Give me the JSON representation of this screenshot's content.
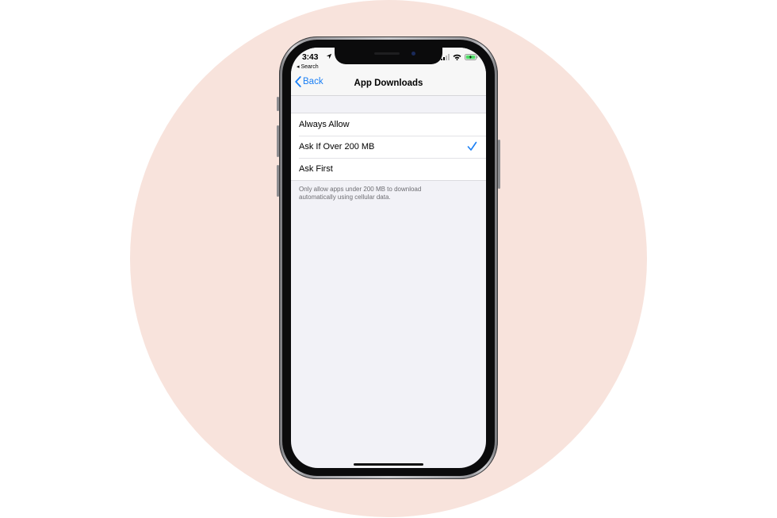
{
  "status_bar": {
    "time": "3:43",
    "back_to_app": "◂ Search"
  },
  "nav": {
    "back_label": "Back",
    "title": "App Downloads"
  },
  "options": [
    {
      "label": "Always Allow",
      "selected": false
    },
    {
      "label": "Ask If Over 200 MB",
      "selected": true
    },
    {
      "label": "Ask First",
      "selected": false
    }
  ],
  "footnote": "Only allow apps under 200 MB to download automatically using cellular data.",
  "colors": {
    "accent": "#1a7ff5",
    "background_circle": "#f8e3dc",
    "battery": "#4cd964"
  }
}
